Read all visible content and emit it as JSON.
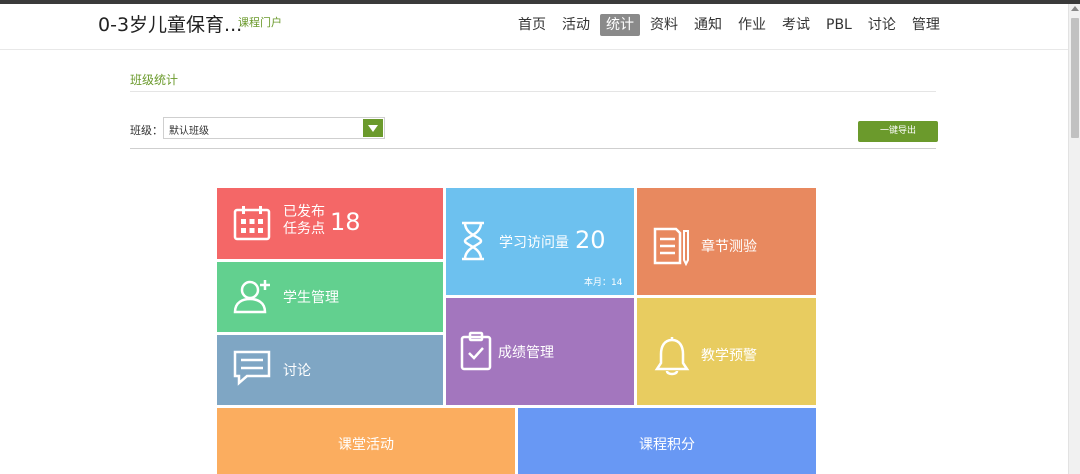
{
  "header": {
    "course_title": "0-3岁儿童保育...",
    "course_portal": "课程门户",
    "nav": [
      "首页",
      "活动",
      "统计",
      "资料",
      "通知",
      "作业",
      "考试",
      "PBL",
      "讨论",
      "管理"
    ],
    "active_nav": "统计"
  },
  "section": {
    "title": "班级统计",
    "class_label": "班级：",
    "class_selected": "默认班级",
    "export_label": "一键导出"
  },
  "tiles": {
    "task": {
      "label_line1": "已发布",
      "label_line2": "任务点",
      "value": "18",
      "icon": "calendar-icon",
      "color": "#f46767"
    },
    "visit": {
      "label": "学习访问量",
      "value": "20",
      "month_label": "本月：14",
      "icon": "hourglass-icon",
      "color": "#6dc1ef"
    },
    "chapter": {
      "label": "章节测验",
      "icon": "document-pen-icon",
      "color": "#e8895f"
    },
    "student": {
      "label": "学生管理",
      "icon": "add-user-icon",
      "color": "#62d08f"
    },
    "grade": {
      "label": "成绩管理",
      "icon": "clipboard-check-icon",
      "color": "#a376be"
    },
    "warn": {
      "label": "教学预警",
      "icon": "bell-icon",
      "color": "#e8cc60"
    },
    "discuss": {
      "label": "讨论",
      "icon": "chat-icon",
      "color": "#7fa6c4"
    },
    "class_activity": {
      "label": "课堂活动",
      "color": "#fbad5f"
    },
    "points": {
      "label": "课程积分",
      "color": "#6898f4"
    }
  }
}
